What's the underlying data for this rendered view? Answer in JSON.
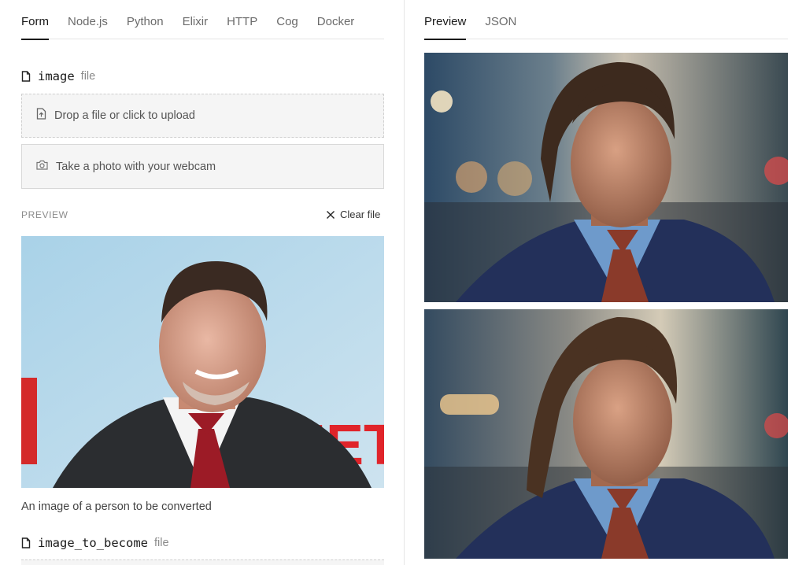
{
  "form_panel": {
    "tabs": [
      {
        "label": "Form",
        "active": true
      },
      {
        "label": "Node.js",
        "active": false
      },
      {
        "label": "Python",
        "active": false
      },
      {
        "label": "Elixir",
        "active": false
      },
      {
        "label": "HTTP",
        "active": false
      },
      {
        "label": "Cog",
        "active": false
      },
      {
        "label": "Docker",
        "active": false
      }
    ],
    "image_field": {
      "name": "image",
      "type": "file",
      "icon": "file-icon",
      "dropzone_label": "Drop a file or click to upload",
      "dropzone_icon": "file-upload-icon",
      "webcam_label": "Take a photo with your webcam",
      "webcam_icon": "camera-icon",
      "preview_label": "PREVIEW",
      "clear_label": "Clear file",
      "clear_icon": "close-icon",
      "description": "An image of a person to be converted"
    },
    "image_to_become_field": {
      "name": "image_to_become",
      "type": "file",
      "icon": "file-icon"
    }
  },
  "output_panel": {
    "tabs": [
      {
        "label": "Preview",
        "active": true
      },
      {
        "label": "JSON",
        "active": false
      }
    ]
  },
  "colors": {
    "accent": "#1a1a1a",
    "muted_text": "#6b6b6b",
    "field_background": "#f5f5f5",
    "border": "#e4e4e4"
  }
}
